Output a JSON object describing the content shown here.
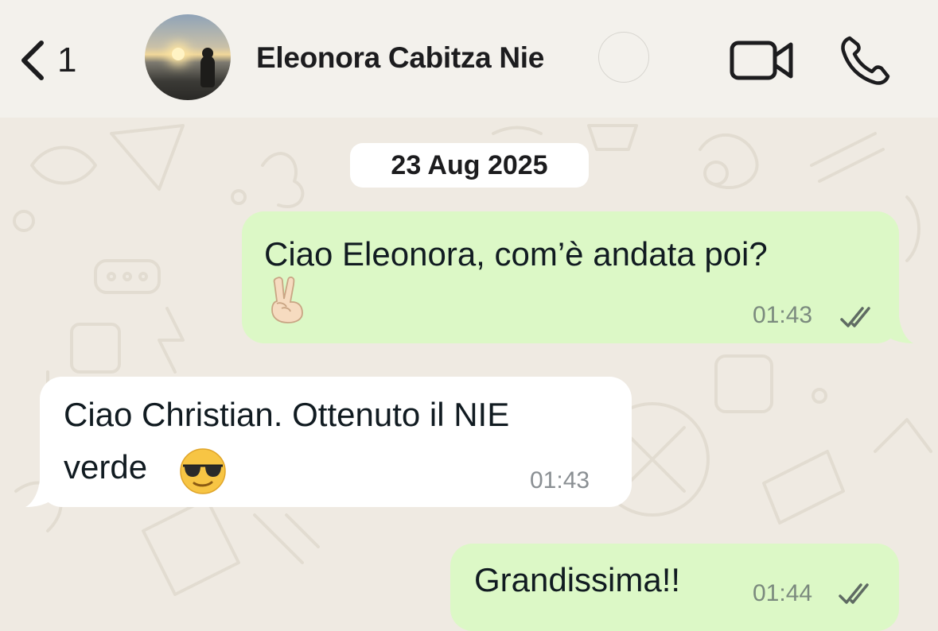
{
  "header": {
    "back_count": "1",
    "contact_name": "Eleonora Cabitza Nie"
  },
  "chat": {
    "date_label": "23 Aug 2025",
    "messages": [
      {
        "direction": "outgoing",
        "text": "Ciao Eleonora, com’è andata poi?",
        "emoji": "✌🏻",
        "time": "01:43",
        "status": "read"
      },
      {
        "direction": "incoming",
        "line1": "Ciao Christian. Ottenuto il NIE",
        "line2": "verde",
        "emoji": "😎",
        "time": "01:43"
      },
      {
        "direction": "outgoing",
        "text": "Grandissima!!",
        "time": "01:44",
        "status": "read"
      }
    ]
  },
  "colors": {
    "outgoing_bubble": "#dcf8c6",
    "incoming_bubble": "#ffffff",
    "wallpaper": "#efeae2",
    "read_ticks": "#5f6b63"
  },
  "icons": [
    "chevron-left-icon",
    "video-camera-icon",
    "phone-icon",
    "double-check-icon"
  ]
}
